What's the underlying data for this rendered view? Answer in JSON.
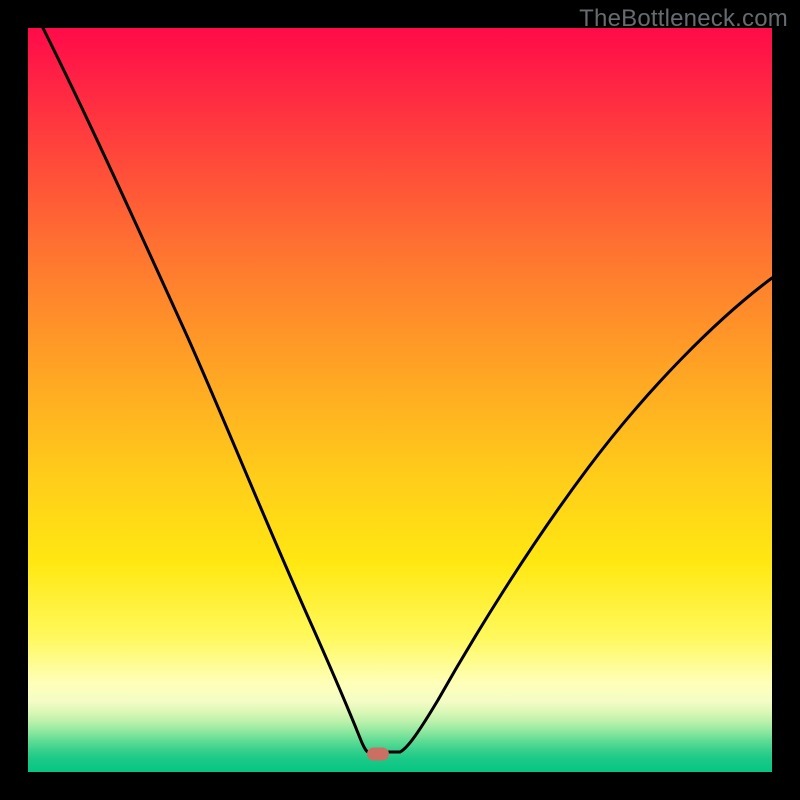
{
  "watermark": "TheBottleneck.com",
  "marker": {
    "x_frac": 0.47,
    "y_frac": 0.976,
    "color": "#cb6e63"
  },
  "chart_data": {
    "type": "line",
    "title": "",
    "xlabel": "",
    "ylabel": "",
    "xlim": [
      0,
      1
    ],
    "ylim": [
      0,
      1
    ],
    "grid": false,
    "legend": false,
    "notes": "V-shaped bottleneck curve over red→yellow→green vertical gradient. No axis ticks or labels are shown; values are normalized 0–1 fractions of the plot area (x left→right, y as distance from top, so 0=top, 1=bottom).",
    "series": [
      {
        "name": "bottleneck-curve",
        "x": [
          0.02,
          0.06,
          0.11,
          0.16,
          0.21,
          0.26,
          0.31,
          0.35,
          0.39,
          0.42,
          0.445,
          0.455,
          0.48,
          0.505,
          0.54,
          0.59,
          0.65,
          0.72,
          0.8,
          0.88,
          0.95,
          1.0
        ],
        "y": [
          0.0,
          0.08,
          0.18,
          0.29,
          0.4,
          0.52,
          0.64,
          0.74,
          0.83,
          0.9,
          0.955,
          0.972,
          0.972,
          0.96,
          0.92,
          0.84,
          0.73,
          0.61,
          0.49,
          0.39,
          0.315,
          0.268
        ]
      }
    ],
    "background_gradient_stops": [
      {
        "pos": 0.0,
        "color": "#ff0b49"
      },
      {
        "pos": 0.18,
        "color": "#ff4a3a"
      },
      {
        "pos": 0.46,
        "color": "#ffa424"
      },
      {
        "pos": 0.72,
        "color": "#ffe812"
      },
      {
        "pos": 0.88,
        "color": "#ffffb8"
      },
      {
        "pos": 0.93,
        "color": "#b6f0aa"
      },
      {
        "pos": 1.0,
        "color": "#05c684"
      }
    ]
  }
}
